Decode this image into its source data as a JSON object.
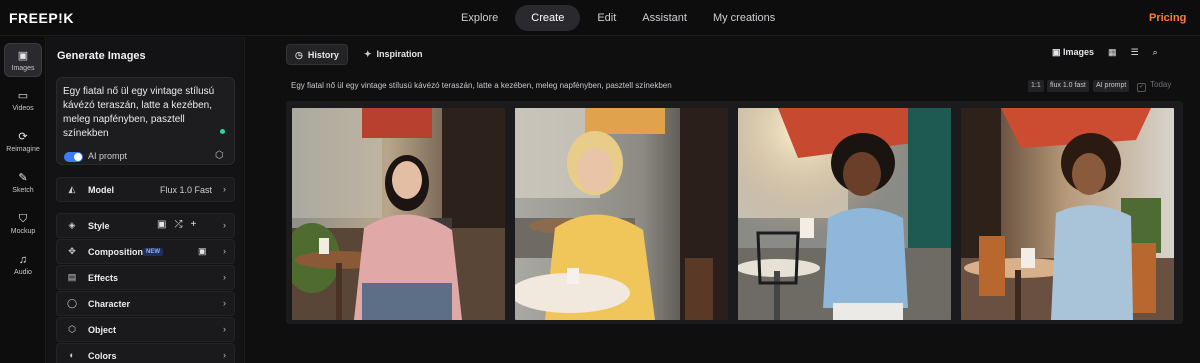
{
  "app": {
    "logo": "FREEP!K",
    "nav": [
      "Explore",
      "Create",
      "Edit",
      "Assistant",
      "My creations"
    ],
    "active_nav": "Create",
    "pricing": "Pricing",
    "accent": "#ff7a35"
  },
  "rail": [
    {
      "label": "Images",
      "icon": "image-icon"
    },
    {
      "label": "Videos",
      "icon": "video-icon"
    },
    {
      "label": "Reimagine",
      "icon": "refresh-icon"
    },
    {
      "label": "Sketch",
      "icon": "pencil-icon"
    },
    {
      "label": "Mockup",
      "icon": "shirt-icon"
    },
    {
      "label": "Audio",
      "icon": "audio-icon"
    }
  ],
  "panel": {
    "title": "Generate Images",
    "prompt": "Egy fiatal nő ül egy vintage stílusú kávézó teraszán, latte a kezében, meleg napfényben, pasztell színekben",
    "ai_prompt_label": "AI prompt",
    "ai_prompt_enabled": true,
    "model_label": "Model",
    "model_value": "Flux 1.0 Fast",
    "rows": [
      {
        "label": "Style",
        "icon": "palette-icon"
      },
      {
        "label": "Composition",
        "icon": "composition-icon",
        "badge": "NEW"
      },
      {
        "label": "Effects",
        "icon": "effects-icon"
      },
      {
        "label": "Character",
        "icon": "person-icon"
      },
      {
        "label": "Object",
        "icon": "cube-icon"
      },
      {
        "label": "Colors",
        "icon": "colors-icon"
      }
    ]
  },
  "main": {
    "tabs": [
      "History",
      "Inspiration"
    ],
    "active_tab": "History",
    "tools": {
      "images_label": "Images"
    },
    "prompt_line": "Egy fiatal nő ül egy vintage stílusú kávézó teraszán, latte a kezében, meleg napfényben, pasztell színekben",
    "meta": [
      "1:1",
      "flux 1.0 fast",
      "AI prompt"
    ],
    "today": "Today"
  }
}
